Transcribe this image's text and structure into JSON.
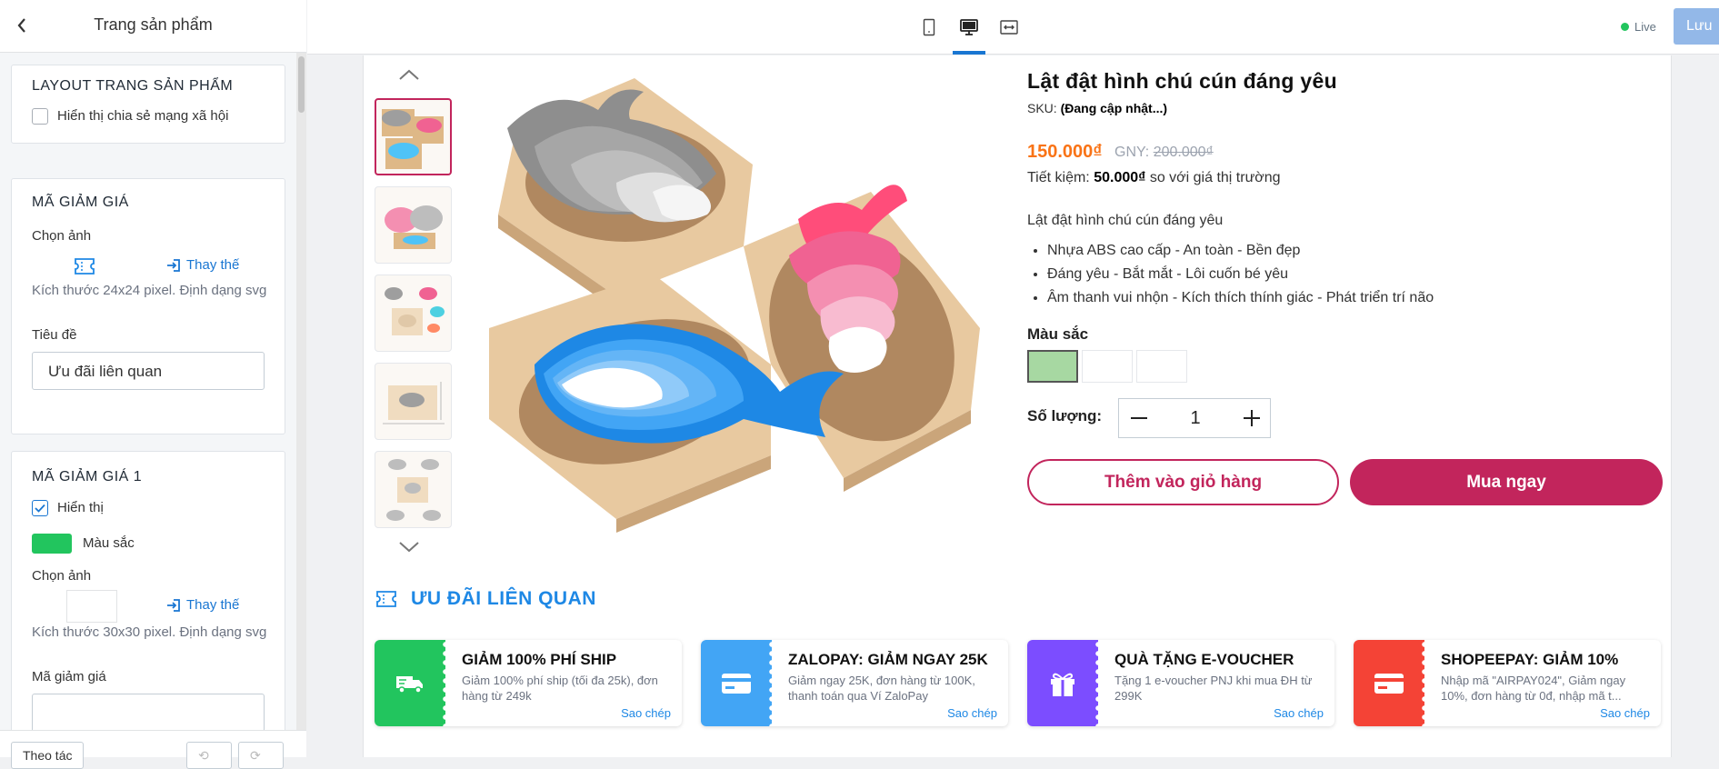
{
  "sidebar": {
    "title": "Trang sản phẩm",
    "layout_card": {
      "title": "LAYOUT TRANG SẢN PHẨM",
      "share_checkbox_label": "Hiển thị chia sẻ mạng xã hội"
    },
    "coupon_card": {
      "title": "MÃ GIẢM GIÁ",
      "choose_image_label": "Chọn ảnh",
      "replace_label": "Thay thế",
      "size_hint": "Kích thước 24x24 pixel. Định dạng svg",
      "heading_label": "Tiêu đề",
      "heading_value": "Ưu đãi liên quan"
    },
    "coupon1_card": {
      "title": "MÃ GIẢM GIÁ 1",
      "show_label": "Hiển thị",
      "color_label": "Màu sắc",
      "choose_image_label": "Chọn ảnh",
      "replace_label": "Thay thế",
      "size_hint": "Kích thước 30x30 pixel. Định dạng svg",
      "code_label": "Mã giảm giá"
    },
    "footer": {
      "theme_label": "Theo tác"
    }
  },
  "topbar": {
    "live_label": "Live",
    "save_label": "Lưu",
    "active_view": "desktop"
  },
  "product": {
    "title": "Lật đật hình chú cún đáng yêu",
    "sku_label": "SKU:",
    "sku_value": "(Đang cập nhật...)",
    "price": "150.000₫",
    "gny_label": "GNY:",
    "old_price": "200.000₫",
    "save_label": "Tiết kiệm:",
    "save_amount": "50.000₫",
    "save_suffix": "so với giá thị trường",
    "description": "Lật đật hình chú cún đáng yêu",
    "bullets": [
      "Nhựa ABS cao cấp - An toàn - Bền đẹp",
      "Đáng yêu - Bắt mắt - Lôi cuốn bé yêu",
      "Âm thanh vui nhộn - Kích thích thính giác - Phát triển trí não"
    ],
    "color_label": "Màu sắc",
    "quantity_label": "Số lượng:",
    "quantity_value": "1",
    "add_to_cart": "Thêm vào giỏ hàng",
    "buy_now": "Mua ngay",
    "colors": {
      "selected_swatch": "#a7d8a2",
      "brand": "#c2255c",
      "price": "#f97316"
    }
  },
  "offers": {
    "title": "ƯU ĐÃI LIÊN QUAN",
    "items": [
      {
        "title": "GIẢM 100% PHÍ SHIP",
        "desc": "Giảm 100% phí ship (tối đa 25k), đơn hàng từ 249k",
        "copy": "Sao chép",
        "color": "#22c55e",
        "icon": "truck-icon"
      },
      {
        "title": "ZALOPAY: GIẢM NGAY 25K",
        "desc": "Giảm ngay 25K, đơn hàng từ 100K, thanh toán qua Ví ZaloPay",
        "copy": "Sao chép",
        "color": "#42a5f5",
        "icon": "card-icon"
      },
      {
        "title": "QUÀ TẶNG E-VOUCHER",
        "desc": "Tặng 1 e-voucher PNJ khi mua ĐH từ 299K",
        "copy": "Sao chép",
        "color": "#7c4dff",
        "icon": "gift-icon"
      },
      {
        "title": "SHOPEEPAY: GIẢM 10%",
        "desc": "Nhập mã \"AIRPAY024\", Giảm ngay 10%, đơn hàng từ 0đ, nhập mã t...",
        "copy": "Sao chép",
        "color": "#f44336",
        "icon": "card-icon"
      }
    ]
  }
}
